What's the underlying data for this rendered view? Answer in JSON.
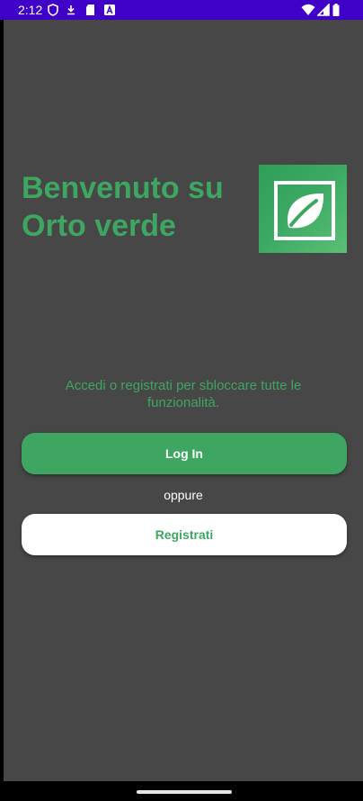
{
  "status_bar": {
    "time": "2:12",
    "background": "#3f00c8",
    "left_icons": [
      "shield-icon",
      "download-icon",
      "sd-card-icon",
      "font-a-icon"
    ],
    "right_icons": [
      "wifi-icon",
      "signal-icon",
      "battery-icon"
    ]
  },
  "welcome": {
    "title": "Benvenuto su Orto verde",
    "subtitle": "Accedi o registrati per sbloccare tutte le funzionalità.",
    "logo_icon": "leaf-icon"
  },
  "actions": {
    "login_label": "Log In",
    "or_label": "oppure",
    "register_label": "Registrati"
  },
  "colors": {
    "accent": "#3ea661",
    "background": "#474747",
    "button_light": "#ffffff"
  }
}
